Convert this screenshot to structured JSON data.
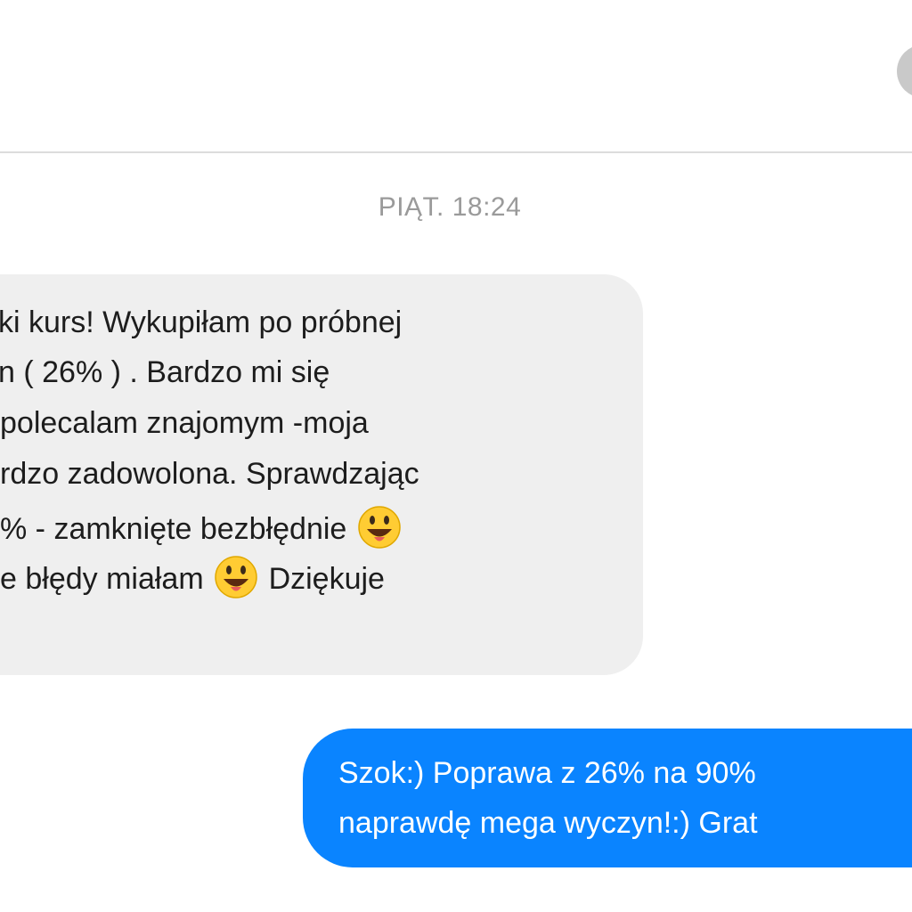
{
  "conversation": {
    "timestamp": "PIĄT. 18:24",
    "incoming": {
      "lines": [
        "ki kurs! Wykupiłam po próbnej",
        "n ( 26% ) . Bardzo mi się",
        "polecalam znajomym  -moja",
        "rdzo zadowolona. Sprawdzając",
        "%  - zamknięte bezbłędnie",
        "e błędy miałam",
        "Dziękuje"
      ],
      "emoji": "grinning-face-with-tongue-emoji"
    },
    "outgoing": {
      "lines": [
        "Szok:) Poprawa z 26% na 90%",
        "naprawdę mega wyczyn!:) Grat"
      ]
    }
  },
  "colors": {
    "outgoing_bubble": "#0a84ff",
    "incoming_bubble": "#efefef",
    "timestamp_text": "#9a9a9a"
  }
}
